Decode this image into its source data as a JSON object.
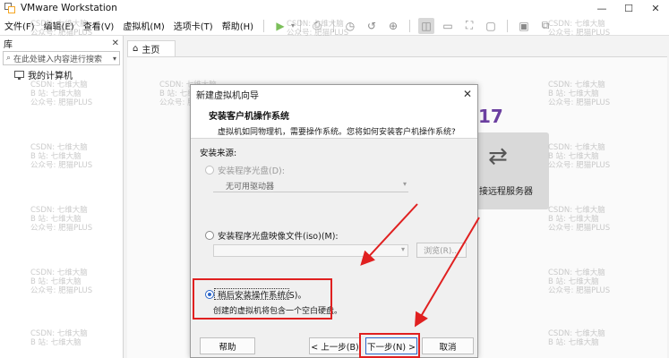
{
  "window": {
    "title": "VMware Workstation",
    "minimize": "—",
    "maximize": "☐",
    "close": "✕"
  },
  "menu": {
    "items": [
      "文件(F)",
      "编辑(E)",
      "查看(V)",
      "虚拟机(M)",
      "选项卡(T)",
      "帮助(H)"
    ]
  },
  "toolbar": {
    "icons": [
      "play-icon",
      "suspend-icon",
      "snapshot-icon",
      "revert-icon",
      "manage-snapshots-icon",
      "sidebar-toggle-icon",
      "thumbnail-icon",
      "fullscreen-icon",
      "unity-icon",
      "console-icon",
      "library-icon"
    ]
  },
  "sidebar": {
    "title": "库",
    "close": "✕",
    "search_placeholder": "在此处键入内容进行搜索",
    "items": [
      {
        "label": "我的计算机"
      }
    ]
  },
  "tabs": [
    {
      "label": "主页"
    }
  ],
  "home": {
    "version_fragment": "17",
    "remote_server_label": "接远程服务器"
  },
  "watermark": {
    "line1": "CSDN: 七维大脑",
    "line2": "B 站: 七维大脑",
    "line3": "公众号: 肥猫PLUS"
  },
  "dialog": {
    "title": "新建虚拟机向导",
    "header_title": "安装客户机操作系统",
    "header_desc": "虚拟机如同物理机，需要操作系统。您将如何安装客户机操作系统?",
    "source_label": "安装来源:",
    "options": [
      {
        "label": "安装程序光盘(D):",
        "checked": false,
        "enabled": false
      },
      {
        "label": "安装程序光盘映像文件(iso)(M):",
        "checked": false,
        "enabled": true
      },
      {
        "label": "稍后安装操作系统(S)。",
        "checked": true,
        "enabled": true
      }
    ],
    "drive_select": "无可用驱动器",
    "iso_value": "",
    "browse_label": "浏览(R)...",
    "later_desc": "创建的虚拟机将包含一个空白硬盘。",
    "buttons": {
      "help": "帮助",
      "back": "< 上一步(B)",
      "next": "下一步(N) >",
      "cancel": "取消"
    }
  },
  "colors": {
    "accent": "#2c66c8",
    "annotation_red": "#e02020",
    "version_purple": "#6b3fa0"
  }
}
